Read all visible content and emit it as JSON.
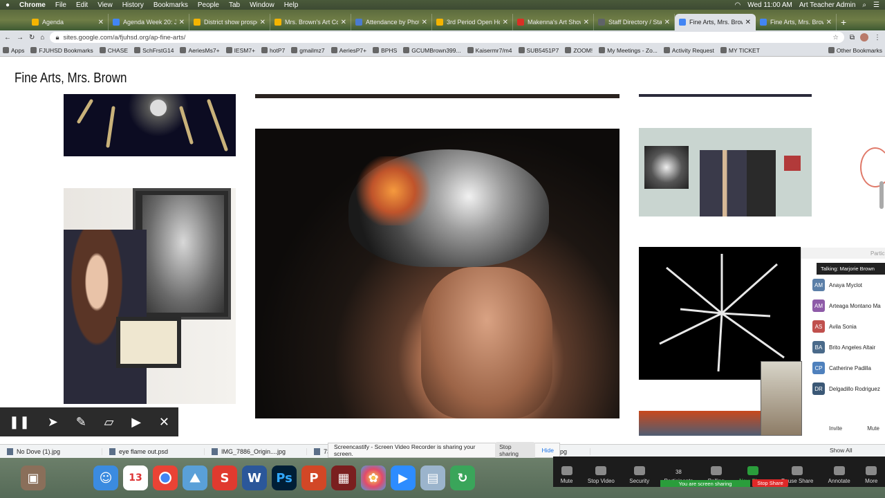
{
  "macbar": {
    "app": "Chrome",
    "menus": [
      "File",
      "Edit",
      "View",
      "History",
      "Bookmarks",
      "People",
      "Tab",
      "Window",
      "Help"
    ],
    "clock": "Wed 11:00 AM",
    "user": "Art Teacher Admin"
  },
  "tabs": [
    {
      "title": "Agenda",
      "color": "#f4b400"
    },
    {
      "title": "Agenda Week 20: Jan",
      "color": "#4285f4"
    },
    {
      "title": "District show prospect",
      "color": "#f4b400"
    },
    {
      "title": "Mrs. Brown's Art Cou",
      "color": "#f4b400"
    },
    {
      "title": "Attendance by Photo",
      "color": "#4a7bd0"
    },
    {
      "title": "3rd Period Open Hou",
      "color": "#f4b400"
    },
    {
      "title": "Makenna's Art Show",
      "color": "#d93025"
    },
    {
      "title": "Staff Directory / Staf",
      "color": "#5f6368"
    },
    {
      "title": "Fine Arts, Mrs. Brown",
      "color": "#4285f4",
      "active": true
    },
    {
      "title": "Fine Arts, Mrs. Brown",
      "color": "#4285f4"
    }
  ],
  "newtab": "+",
  "omnibox": {
    "url": "sites.google.com/a/fjuhsd.org/ap-fine-arts/"
  },
  "bookmarks": [
    "Apps",
    "FJUHSD Bookmarks",
    "CHASE",
    "SchFrstG14",
    "AeriesMs7+",
    "IESM7+",
    "hotP7",
    "gmailmz7",
    "AeriesP7+",
    "BPHS",
    "GCUMBrown399...",
    "Kaisermr7/m4",
    "SUB5451P7",
    "ZOOM!",
    "My Meetings - Zo...",
    "Activity Request",
    "MY TICKET",
    "Other Bookmarks"
  ],
  "page": {
    "title": "Fine Arts, Mrs. Brown"
  },
  "downloads": [
    "No Dove (1).jpg",
    "eye flame out.psd",
    "IMG_7886_Origin....jpg",
    "73_",
    "...inal.jpg"
  ],
  "notice": {
    "text": "Screencastify - Screen Video Recorder is sharing your screen.",
    "stop": "Stop sharing",
    "hide": "Hide"
  },
  "zoom": {
    "controls": [
      "Mute",
      "Stop Video",
      "Security",
      "Participants",
      "Polling",
      "New Share",
      "Pause Share",
      "Annotate",
      "More"
    ],
    "participant_count": "38",
    "sharing_label": "You are screen sharing",
    "stop_share": "Stop Share",
    "show_all": "Show All"
  },
  "participants_panel": {
    "title": "Participa",
    "talking": "Talking: Marjorie Brown",
    "people": [
      {
        "initials": "AM",
        "name": "Anaya Myclot",
        "color": "#5b7fa8"
      },
      {
        "initials": "AM",
        "name": "Arteaga Montano Ma",
        "color": "#8e5ba8"
      },
      {
        "initials": "AS",
        "name": "Avila Sonia",
        "color": "#c0504d"
      },
      {
        "initials": "BA",
        "name": "Brito Angeles Altair",
        "color": "#4a6a8a"
      },
      {
        "initials": "CP",
        "name": "Catherine Padilla",
        "color": "#4f81bd"
      },
      {
        "initials": "DR",
        "name": "Delgadillo Rodriguez",
        "color": "#3b5876"
      }
    ],
    "invite": "Invite",
    "mute": "Mute"
  },
  "dock_date": "13"
}
